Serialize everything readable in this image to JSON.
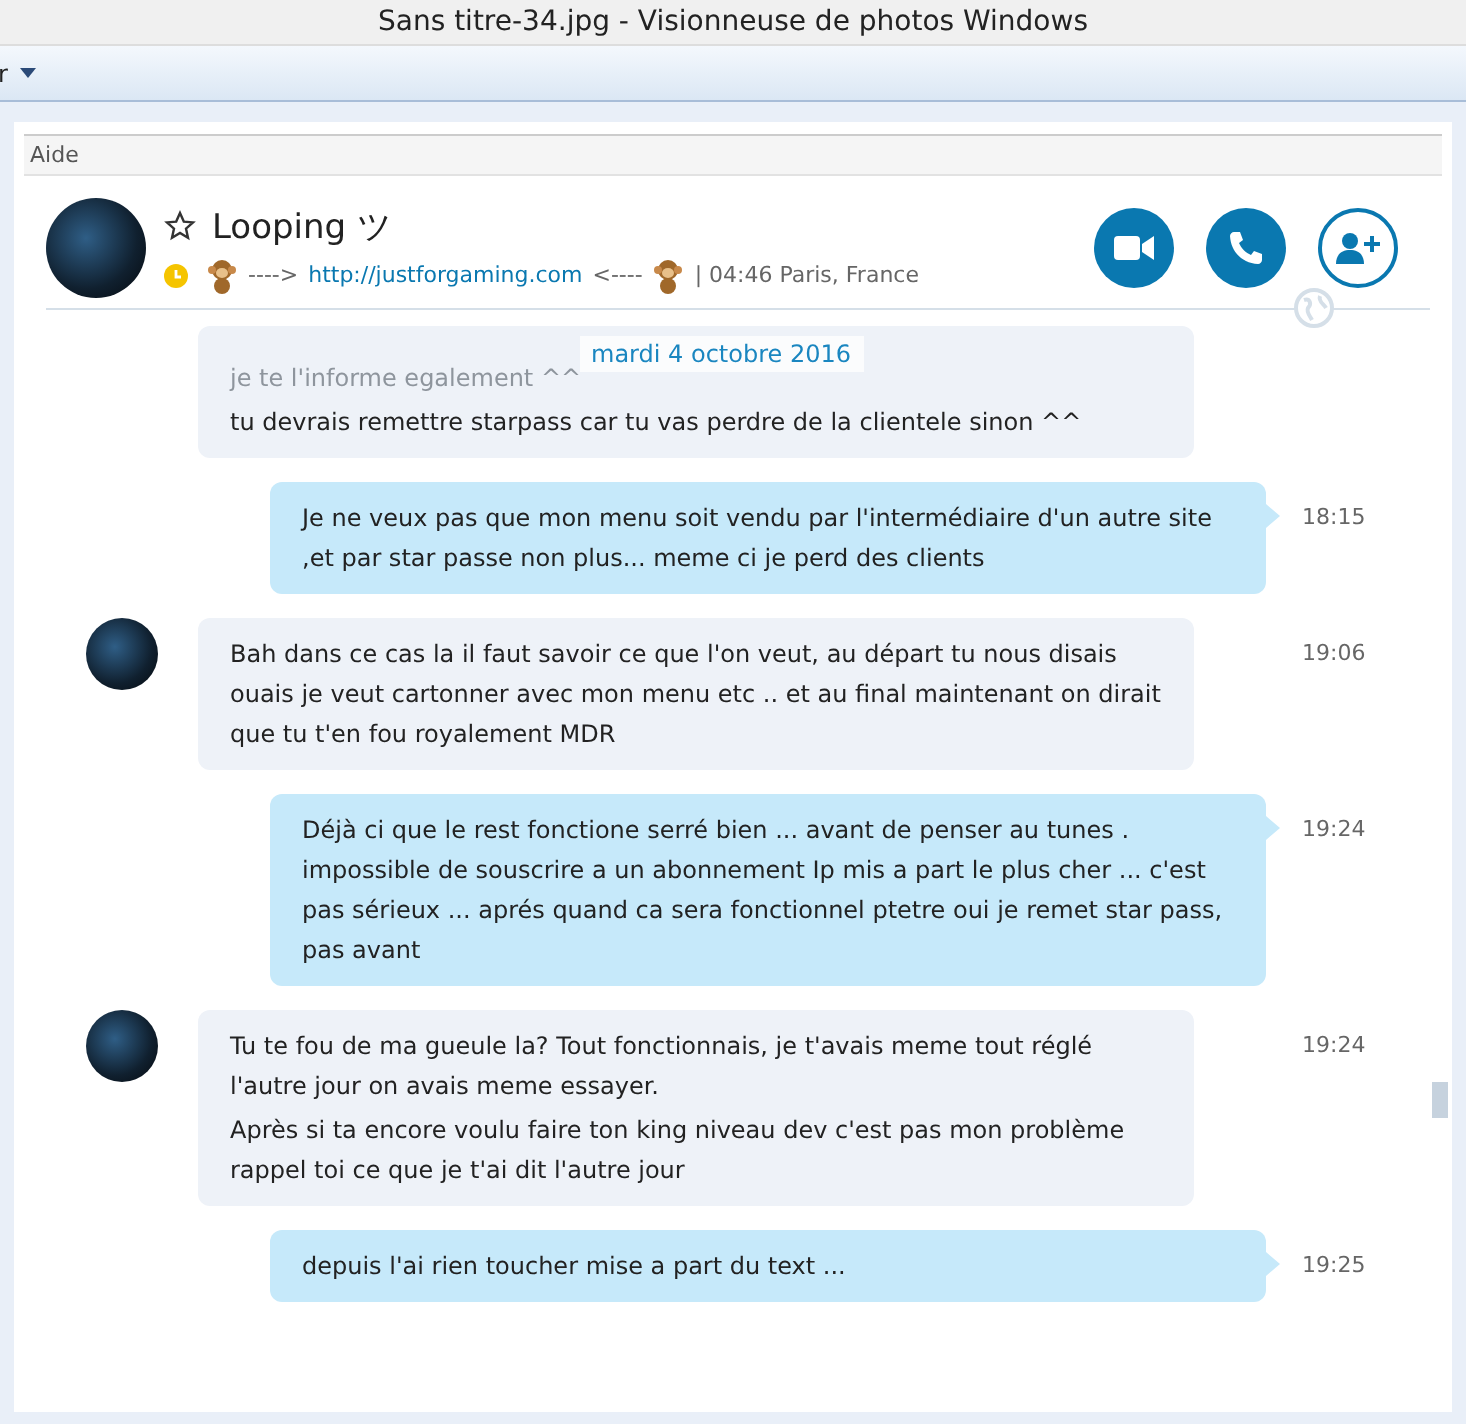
{
  "window": {
    "title": "Sans titre-34.jpg - Visionneuse de photos Windows"
  },
  "toolbar": {
    "menu_label": "r"
  },
  "menu": {
    "label": "Aide"
  },
  "contact": {
    "name": "Looping ツ",
    "favorite": false,
    "status_prefix": "---->",
    "link": "http://justforgaming.com",
    "status_suffix": "<----",
    "time_location": "| 04:46 Paris, France"
  },
  "date_header": "mardi 4 octobre 2016",
  "messages": [
    {
      "kind": "incoming",
      "avatar": false,
      "faded_line": "je te l'informe egalement ^^",
      "paragraphs": [
        [
          "tu devrais remettre starpass car tu vas perdre de la clientele sinon ^^"
        ]
      ]
    },
    {
      "kind": "outgoing",
      "time": "18:15",
      "paragraphs": [
        [
          "Je ne veux pas que mon menu soit vendu par l'intermédiaire d'un autre site",
          ",et par star passe non plus... meme ci je perd des clients"
        ]
      ]
    },
    {
      "kind": "incoming",
      "avatar": true,
      "time": "19:06",
      "paragraphs": [
        [
          "Bah dans ce cas la il faut savoir ce que l'on veut, au départ tu nous disais",
          "ouais je veut cartonner avec mon menu etc .. et au final maintenant on dirait",
          "que tu t'en fou royalement MDR"
        ]
      ]
    },
    {
      "kind": "outgoing",
      "time": "19:24",
      "paragraphs": [
        [
          "Déjà ci que le rest fonctione serré bien ...  avant de penser au tunes .",
          "impossible de souscrire a un abonnement Ip mis a part le plus cher ... c'est",
          "pas sérieux ... aprés quand ca sera fonctionnel ptetre oui je remet star pass,",
          "pas avant"
        ]
      ]
    },
    {
      "kind": "incoming",
      "avatar": true,
      "time": "19:24",
      "paragraphs": [
        [
          "Tu te fou de ma gueule la?  Tout fonctionnais, je t'avais meme tout réglé",
          "l'autre jour on avais meme essayer."
        ],
        [
          "Après si ta encore voulu faire ton king niveau dev c'est pas mon problème",
          "rappel toi ce que je t'ai dit l'autre jour"
        ]
      ]
    },
    {
      "kind": "outgoing",
      "time": "19:25",
      "paragraphs": [
        [
          "depuis l'ai rien toucher mise a part du text ..."
        ]
      ]
    }
  ]
}
